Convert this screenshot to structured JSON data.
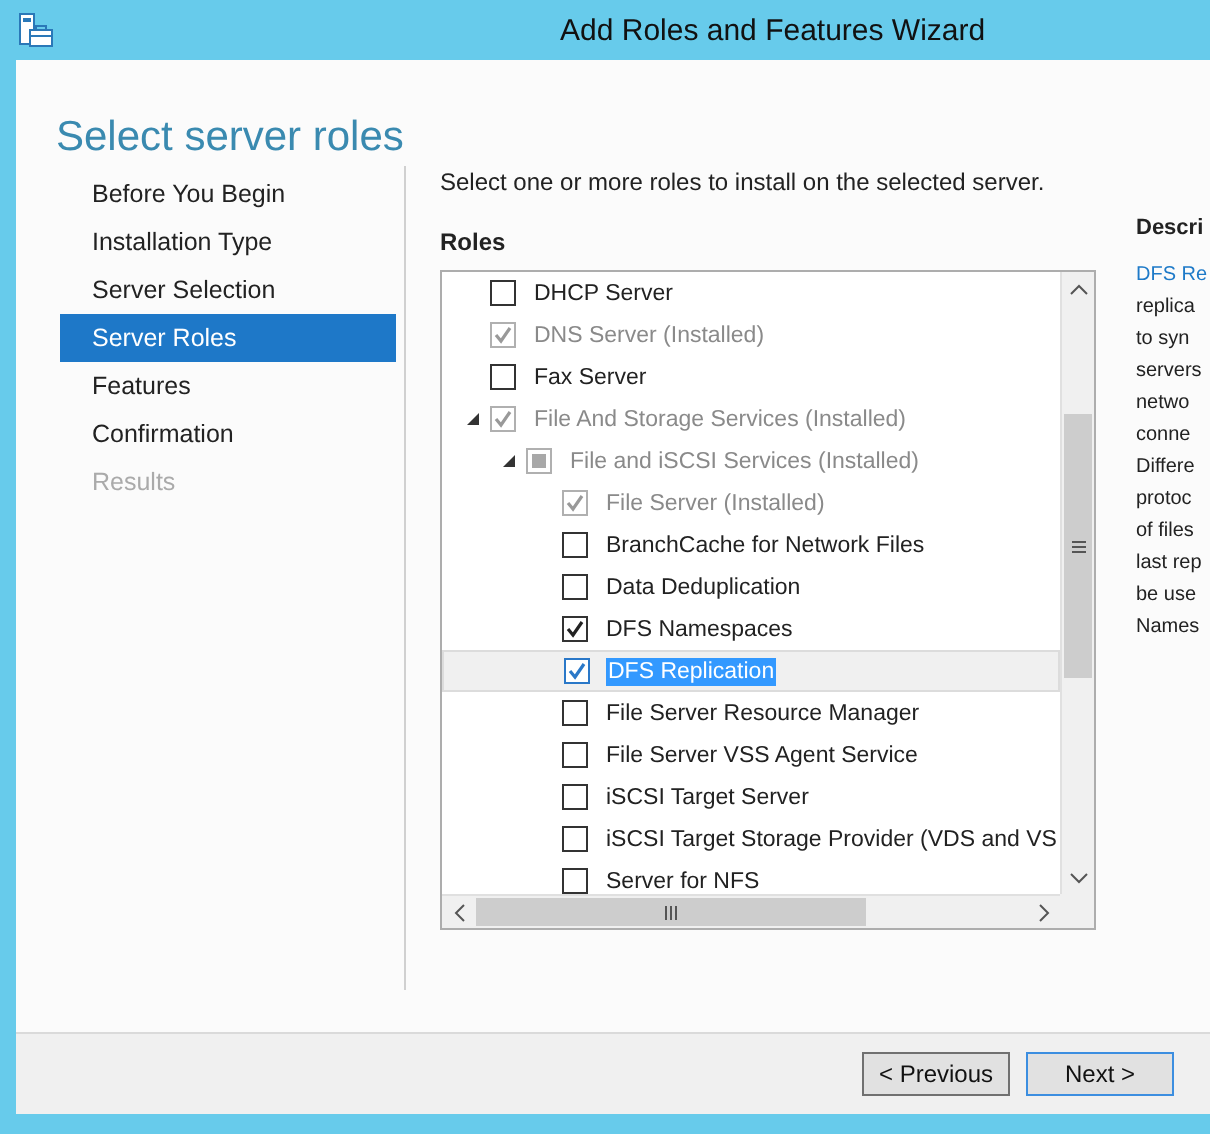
{
  "window": {
    "title": "Add Roles and Features Wizard"
  },
  "page_title": "Select server roles",
  "nav": [
    {
      "label": "Before You Begin",
      "selected": false,
      "disabled": false
    },
    {
      "label": "Installation Type",
      "selected": false,
      "disabled": false
    },
    {
      "label": "Server Selection",
      "selected": false,
      "disabled": false
    },
    {
      "label": "Server Roles",
      "selected": true,
      "disabled": false
    },
    {
      "label": "Features",
      "selected": false,
      "disabled": false
    },
    {
      "label": "Confirmation",
      "selected": false,
      "disabled": false
    },
    {
      "label": "Results",
      "selected": false,
      "disabled": true
    }
  ],
  "instruction": "Select one or more roles to install on the selected server.",
  "roles": {
    "heading": "Roles",
    "items": [
      {
        "label": "DHCP Server",
        "checked": false,
        "disabled": false,
        "selected": false
      },
      {
        "label": "DNS Server (Installed)",
        "checked": true,
        "disabled": true,
        "selected": false
      },
      {
        "label": "Fax Server",
        "checked": false,
        "disabled": false,
        "selected": false
      },
      {
        "label": "File And Storage Services (Installed)",
        "checked": true,
        "disabled": true,
        "selected": false,
        "expanded": true,
        "children": [
          {
            "label": "File and iSCSI Services (Installed)",
            "indeterminate": true,
            "disabled": true,
            "selected": false,
            "expanded": true,
            "children": [
              {
                "label": "File Server (Installed)",
                "checked": true,
                "disabled": true,
                "selected": false
              },
              {
                "label": "BranchCache for Network Files",
                "checked": false,
                "disabled": false,
                "selected": false
              },
              {
                "label": "Data Deduplication",
                "checked": false,
                "disabled": false,
                "selected": false
              },
              {
                "label": "DFS Namespaces",
                "checked": true,
                "disabled": false,
                "selected": false
              },
              {
                "label": "DFS Replication",
                "checked": true,
                "disabled": false,
                "selected": true
              },
              {
                "label": "File Server Resource Manager",
                "checked": false,
                "disabled": false,
                "selected": false
              },
              {
                "label": "File Server VSS Agent Service",
                "checked": false,
                "disabled": false,
                "selected": false
              },
              {
                "label": "iSCSI Target Server",
                "checked": false,
                "disabled": false,
                "selected": false
              },
              {
                "label": "iSCSI Target Storage Provider (VDS and VS",
                "checked": false,
                "disabled": false,
                "selected": false
              },
              {
                "label": "Server for NFS",
                "checked": false,
                "disabled": false,
                "selected": false
              }
            ]
          }
        ]
      }
    ]
  },
  "description": {
    "heading": "Descri",
    "lines": [
      {
        "text": "DFS Re",
        "kind": "link"
      },
      {
        "text": "replica",
        "kind": "text"
      },
      {
        "text": "to syn",
        "kind": "text"
      },
      {
        "text": "servers",
        "kind": "text"
      },
      {
        "text": "netwo",
        "kind": "text"
      },
      {
        "text": "conne",
        "kind": "text"
      },
      {
        "text": "Differe",
        "kind": "text"
      },
      {
        "text": "protoc",
        "kind": "text"
      },
      {
        "text": "of files",
        "kind": "text"
      },
      {
        "text": "last rep",
        "kind": "text"
      },
      {
        "text": "be use",
        "kind": "text"
      },
      {
        "text": "Names",
        "kind": "text"
      }
    ]
  },
  "buttons": [
    {
      "label": "< Previous",
      "default": false
    },
    {
      "label": "Next >",
      "default": true
    }
  ]
}
